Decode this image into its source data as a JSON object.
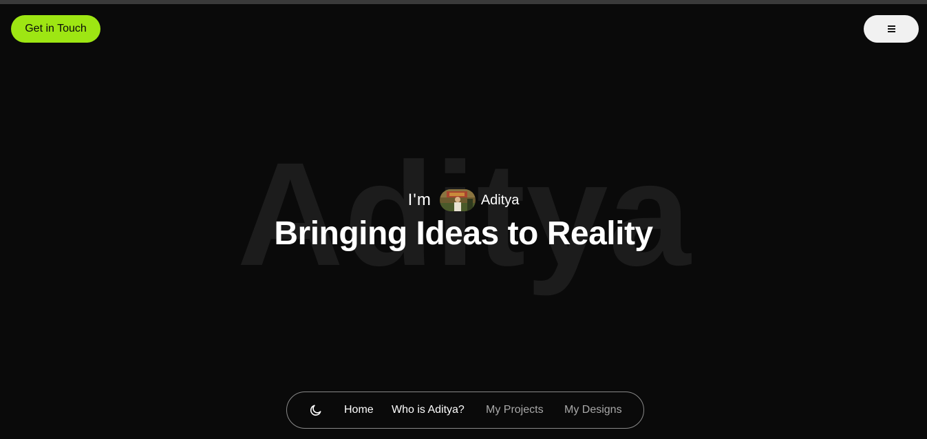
{
  "header": {
    "cta_label": "Get in Touch",
    "menu_icon": "hamburger-menu-icon"
  },
  "hero": {
    "background_word": "Aditya",
    "intro_prefix": "I'm",
    "avatar": "profile-photo",
    "name": "Aditya",
    "headline": "Bringing Ideas to Reality"
  },
  "nav": {
    "theme_icon": "moon-icon",
    "items": [
      {
        "label": "Home",
        "active": true
      },
      {
        "label": "Who is Aditya?",
        "active": true
      },
      {
        "label": "My Projects",
        "active": false
      },
      {
        "label": "My Designs",
        "active": false
      }
    ]
  },
  "colors": {
    "background": "#0a0a0a",
    "accent": "#9ee613",
    "background_word": "#1c1c1c",
    "nav_inactive": "#a9a9a9"
  }
}
